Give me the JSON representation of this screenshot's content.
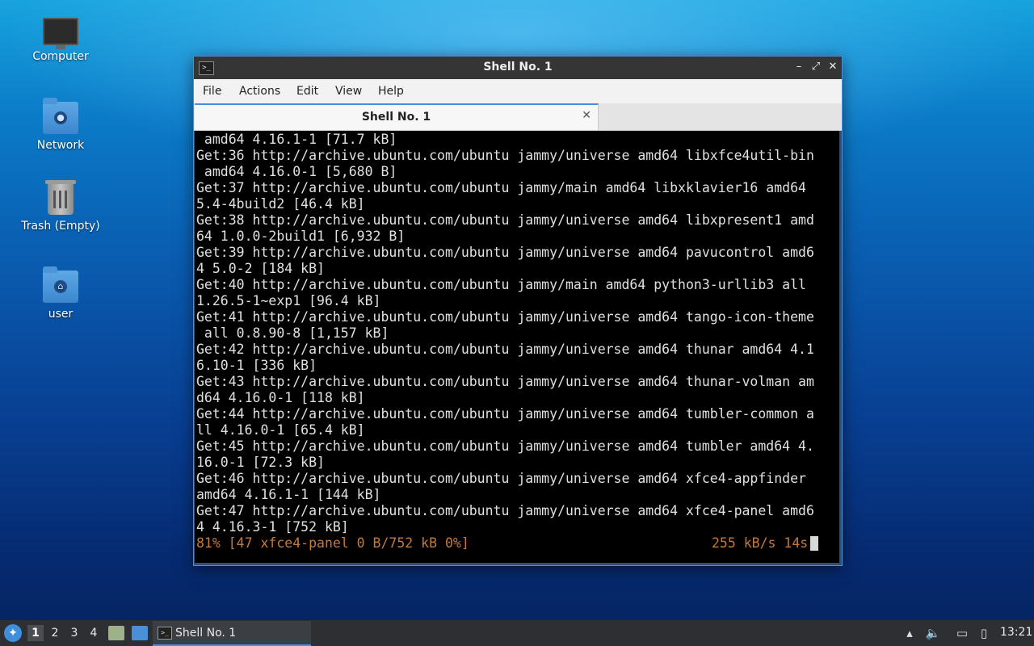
{
  "desktop": {
    "icons": [
      {
        "label": "Computer",
        "icon": "computer-icon"
      },
      {
        "label": "Network",
        "icon": "network-folder-icon"
      },
      {
        "label": "Trash (Empty)",
        "icon": "trash-icon"
      },
      {
        "label": "user",
        "icon": "home-folder-icon"
      }
    ]
  },
  "window": {
    "title": "Shell No. 1",
    "menu": [
      "File",
      "Actions",
      "Edit",
      "View",
      "Help"
    ],
    "tab_label": "Shell No. 1",
    "terminal_lines": [
      " amd64 4.16.1-1 [71.7 kB]",
      "Get:36 http://archive.ubuntu.com/ubuntu jammy/universe amd64 libxfce4util-bin",
      " amd64 4.16.0-1 [5,680 B]",
      "Get:37 http://archive.ubuntu.com/ubuntu jammy/main amd64 libxklavier16 amd64",
      "5.4-4build2 [46.4 kB]",
      "Get:38 http://archive.ubuntu.com/ubuntu jammy/universe amd64 libxpresent1 amd",
      "64 1.0.0-2build1 [6,932 B]",
      "Get:39 http://archive.ubuntu.com/ubuntu jammy/universe amd64 pavucontrol amd6",
      "4 5.0-2 [184 kB]",
      "Get:40 http://archive.ubuntu.com/ubuntu jammy/main amd64 python3-urllib3 all",
      "1.26.5-1~exp1 [96.4 kB]",
      "Get:41 http://archive.ubuntu.com/ubuntu jammy/universe amd64 tango-icon-theme",
      " all 0.8.90-8 [1,157 kB]",
      "Get:42 http://archive.ubuntu.com/ubuntu jammy/universe amd64 thunar amd64 4.1",
      "6.10-1 [336 kB]",
      "Get:43 http://archive.ubuntu.com/ubuntu jammy/universe amd64 thunar-volman am",
      "d64 4.16.0-1 [118 kB]",
      "Get:44 http://archive.ubuntu.com/ubuntu jammy/universe amd64 tumbler-common a",
      "ll 4.16.0-1 [65.4 kB]",
      "Get:45 http://archive.ubuntu.com/ubuntu jammy/universe amd64 tumbler amd64 4.",
      "16.0-1 [72.3 kB]",
      "Get:46 http://archive.ubuntu.com/ubuntu jammy/universe amd64 xfce4-appfinder",
      "amd64 4.16.1-1 [144 kB]",
      "Get:47 http://archive.ubuntu.com/ubuntu jammy/universe amd64 xfce4-panel amd6",
      "4 4.16.3-1 [752 kB]"
    ],
    "status_left": "81% [47 xfce4-panel 0 B/752 kB 0%]",
    "status_right": "255 kB/s 14s"
  },
  "taskbar": {
    "workspaces": [
      "1",
      "2",
      "3",
      "4"
    ],
    "active_workspace": "1",
    "task_label": "Shell No. 1",
    "clock": "13:21"
  },
  "colors": {
    "accent": "#4a90d9",
    "status_text": "#c47a3c",
    "terminal_bg": "#000000"
  }
}
